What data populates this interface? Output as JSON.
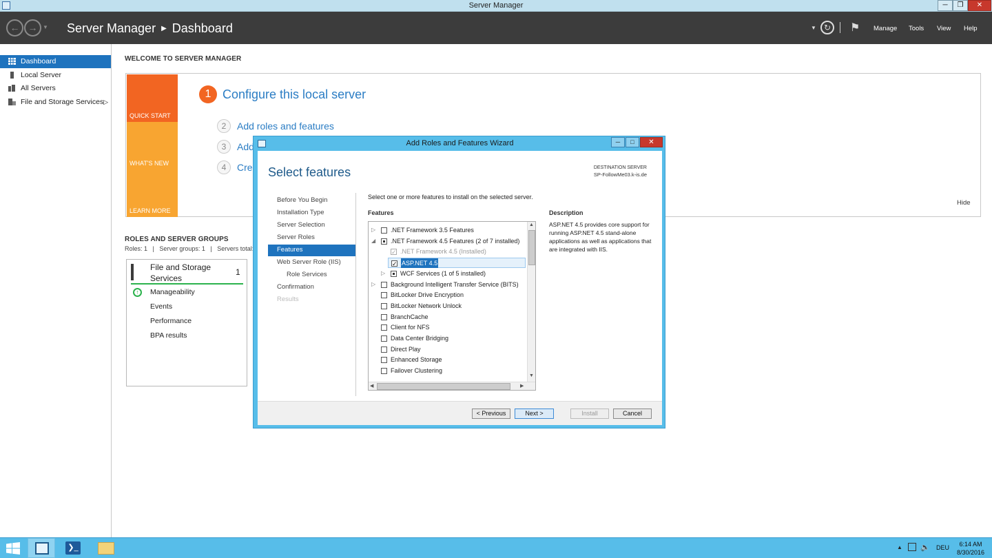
{
  "window": {
    "title": "Server Manager"
  },
  "header": {
    "app": "Server Manager",
    "page": "Dashboard",
    "menus": [
      "Manage",
      "Tools",
      "View",
      "Help"
    ]
  },
  "sidebar": {
    "items": [
      {
        "label": "Dashboard",
        "icon": "dashboard-icon"
      },
      {
        "label": "Local Server",
        "icon": "server-icon"
      },
      {
        "label": "All Servers",
        "icon": "servers-icon"
      },
      {
        "label": "File and Storage Services",
        "icon": "storage-icon"
      }
    ]
  },
  "welcome": {
    "heading": "WELCOME TO SERVER MANAGER",
    "tiles": [
      "QUICK START",
      "WHAT'S NEW",
      "LEARN MORE"
    ],
    "step1_num": "1",
    "step1": "Configure this local server",
    "steps": [
      {
        "num": "2",
        "label": "Add roles and features"
      },
      {
        "num": "3",
        "label": "Add"
      },
      {
        "num": "4",
        "label": "Crea"
      }
    ],
    "hide": "Hide"
  },
  "roles": {
    "heading": "ROLES AND SERVER GROUPS",
    "summary": "Roles: 1   |   Server groups: 1   |   Servers total: 1",
    "card": {
      "title": "File and Storage Services",
      "count": "1",
      "items": [
        "Manageability",
        "Events",
        "Performance",
        "BPA results"
      ]
    }
  },
  "wizard": {
    "title": "Add Roles and Features Wizard",
    "heading": "Select features",
    "destination_label": "DESTINATION SERVER",
    "destination_server": "SP-FollowMe03.k-is.de",
    "nav": [
      {
        "label": "Before You Begin",
        "state": "normal"
      },
      {
        "label": "Installation Type",
        "state": "normal"
      },
      {
        "label": "Server Selection",
        "state": "normal"
      },
      {
        "label": "Server Roles",
        "state": "normal"
      },
      {
        "label": "Features",
        "state": "selected"
      },
      {
        "label": "Web Server Role (IIS)",
        "state": "normal"
      },
      {
        "label": "Role Services",
        "state": "sub"
      },
      {
        "label": "Confirmation",
        "state": "normal"
      },
      {
        "label": "Results",
        "state": "disabled"
      }
    ],
    "instruction": "Select one or more features to install on the selected server.",
    "features_label": "Features",
    "description_label": "Description",
    "description": "ASP.NET 4.5 provides core support for running ASP.NET 4.5 stand-alone applications as well as applications that are integrated with IIS.",
    "features": [
      {
        "label": ".NET Framework 3.5 Features",
        "level": 0,
        "expander": "▷",
        "state": "unchecked"
      },
      {
        "label": ".NET Framework 4.5 Features (2 of 7 installed)",
        "level": 0,
        "expander": "◢",
        "state": "partial"
      },
      {
        "label": ".NET Framework 4.5 (Installed)",
        "level": 1,
        "expander": "",
        "state": "disabled-checked"
      },
      {
        "label": "ASP.NET 4.5",
        "level": 1,
        "expander": "",
        "state": "checked",
        "selected": true
      },
      {
        "label": "WCF Services (1 of 5 installed)",
        "level": 1,
        "expander": "▷",
        "state": "partial"
      },
      {
        "label": "Background Intelligent Transfer Service (BITS)",
        "level": 0,
        "expander": "▷",
        "state": "unchecked"
      },
      {
        "label": "BitLocker Drive Encryption",
        "level": 0,
        "expander": "",
        "state": "unchecked"
      },
      {
        "label": "BitLocker Network Unlock",
        "level": 0,
        "expander": "",
        "state": "unchecked"
      },
      {
        "label": "BranchCache",
        "level": 0,
        "expander": "",
        "state": "unchecked"
      },
      {
        "label": "Client for NFS",
        "level": 0,
        "expander": "",
        "state": "unchecked"
      },
      {
        "label": "Data Center Bridging",
        "level": 0,
        "expander": "",
        "state": "unchecked"
      },
      {
        "label": "Direct Play",
        "level": 0,
        "expander": "",
        "state": "unchecked"
      },
      {
        "label": "Enhanced Storage",
        "level": 0,
        "expander": "",
        "state": "unchecked"
      },
      {
        "label": "Failover Clustering",
        "level": 0,
        "expander": "",
        "state": "unchecked"
      }
    ],
    "buttons": {
      "previous": "< Previous",
      "next": "Next >",
      "install": "Install",
      "cancel": "Cancel"
    }
  },
  "taskbar": {
    "language": "DEU",
    "time": "6:14 AM",
    "date": "8/30/2016"
  },
  "colors": {
    "accent": "#1e73be",
    "header_bg": "#3c3c3c",
    "quick_start": "#f26522",
    "whats_new": "#f8a531",
    "learn_more": "#f8a531",
    "wizard_frame": "#57bde9"
  }
}
